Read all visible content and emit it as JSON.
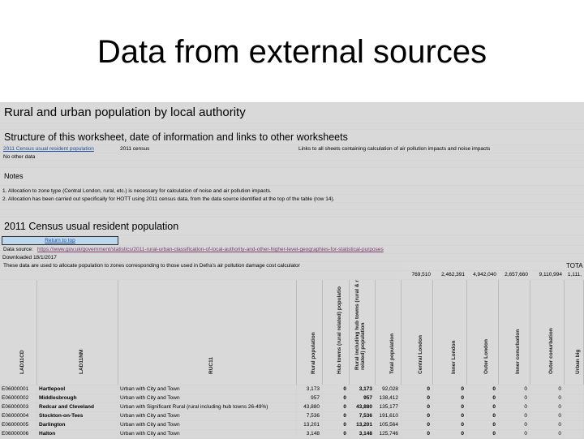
{
  "slide_title": "Data from external sources",
  "sheet": {
    "title": "Rural and urban population by local authority",
    "structure_heading": "Structure of this worksheet, date of information and links to other worksheets",
    "structure_link": "2011 Census usual resident population",
    "structure_date": "2011 census",
    "structure_links_text": "Links to all sheets containing calculation of air pollution impacts and noise impacts",
    "no_other_data": "No other data",
    "notes_heading": "Notes",
    "note_1": "1. Allocation to zone type (Central London, rural, etc.) is necessary for calculation of noise and air pollution impacts.",
    "note_2": "2. Allocation has been carried out specifically for HOTT using 2011 census data, from the data source identified at the top of the table (row 14).",
    "section_heading": "2011 Census usual resident population",
    "return_to_top": "Return to top",
    "data_source_label": "Data source:",
    "data_source_url": "https://www.gov.uk/government/statistics/2011-rural-urban-classification-of-local-authority-and-other-higher-level-geographies-for-statistical-purposes",
    "downloaded": "Downloaded 18/1/2017",
    "usage_note": "These data are used to allocate population to zones corresponding to those used in Defra's air pollution damage cost calculator",
    "total_label": "TOTA",
    "totals": [
      "769,510",
      "2,462,391",
      "4,942,040",
      "2,657,660",
      "9,110,994",
      "1,111,"
    ],
    "headers": [
      "LAD11CD",
      "LAD11NM",
      "RUC11",
      "Rural population",
      "Hub towns (rural related) populatio",
      "Rural including hub towns (rural & rura related) population",
      "Total population",
      "Central London",
      "Inner London",
      "Outer London",
      "Inner conurbation",
      "Outer conurbation",
      "Urban big"
    ],
    "rows": [
      [
        "E06000001",
        "Hartlepool",
        "Urban with City and Town",
        "3,173",
        "0",
        "3,173",
        "92,028",
        "0",
        "0",
        "0",
        "0",
        "0",
        ""
      ],
      [
        "E06000002",
        "Middlesbrough",
        "Urban with City and Town",
        "957",
        "0",
        "957",
        "138,412",
        "0",
        "0",
        "0",
        "0",
        "0",
        ""
      ],
      [
        "E06000003",
        "Redcar and Cleveland",
        "Urban with Significant Rural (rural including hub towns 26-49%)",
        "43,880",
        "0",
        "43,880",
        "135,177",
        "0",
        "0",
        "0",
        "0",
        "0",
        ""
      ],
      [
        "E06000004",
        "Stockton-on-Tees",
        "Urban with City and Town",
        "7,536",
        "0",
        "7,536",
        "191,610",
        "0",
        "0",
        "0",
        "0",
        "0",
        ""
      ],
      [
        "E06000005",
        "Darlington",
        "Urban with City and Town",
        "13,201",
        "0",
        "13,201",
        "105,564",
        "0",
        "0",
        "0",
        "0",
        "0",
        ""
      ],
      [
        "E06000006",
        "Halton",
        "Urban with City and Town",
        "3,148",
        "0",
        "3,148",
        "125,746",
        "0",
        "0",
        "0",
        "0",
        "0",
        ""
      ]
    ]
  }
}
